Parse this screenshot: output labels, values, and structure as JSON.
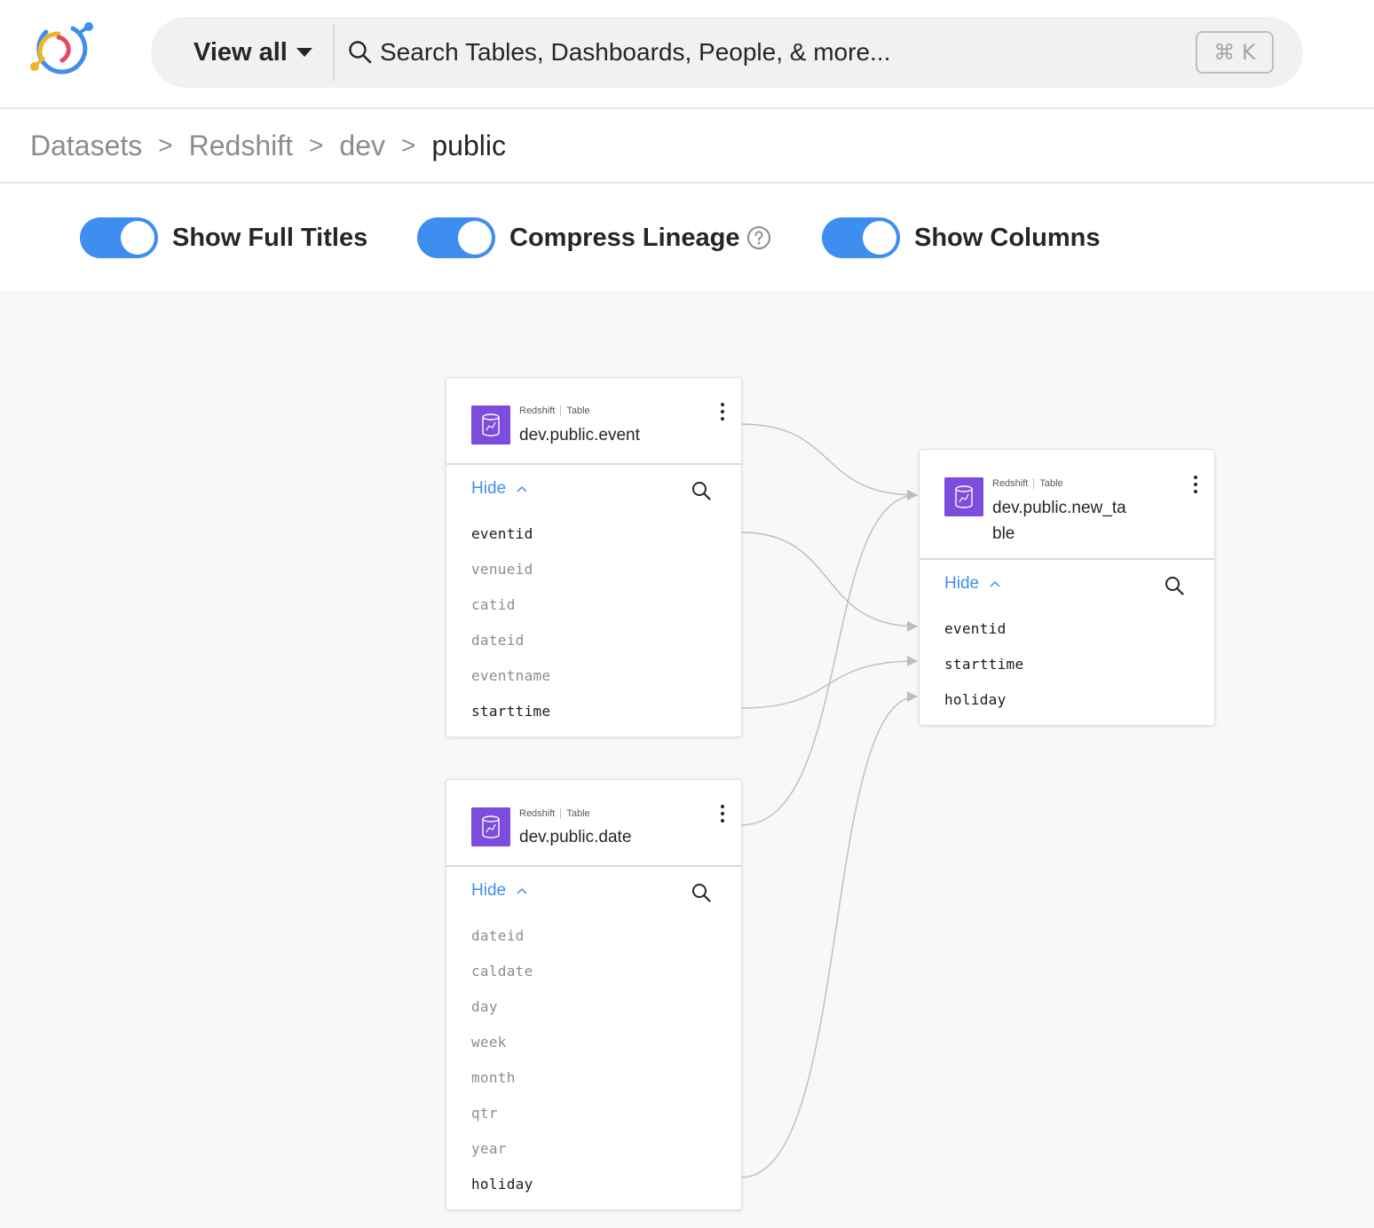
{
  "header": {
    "view_all_label": "View all",
    "search_placeholder": "Search Tables, Dashboards, People, & more...",
    "shortcut": "⌘ K"
  },
  "breadcrumb": [
    "Datasets",
    "Redshift",
    "dev",
    "public"
  ],
  "breadcrumb_sep": ">",
  "toggles": {
    "full_titles": {
      "label": "Show Full Titles",
      "on": true
    },
    "compress_lineage": {
      "label": "Compress Lineage",
      "on": true
    },
    "show_columns": {
      "label": "Show Columns",
      "on": true
    }
  },
  "colors": {
    "accent": "#3e8ef0",
    "node_icon": "#7c4ddc",
    "edge": "#bdbdbd"
  },
  "nodes": {
    "event": {
      "platform": "Redshift",
      "type": "Table",
      "title": "dev.public.event",
      "hide_label": "Hide",
      "columns": [
        "eventid",
        "venueid",
        "catid",
        "dateid",
        "eventname",
        "starttime"
      ],
      "active_columns": [
        "eventid",
        "starttime"
      ]
    },
    "date": {
      "platform": "Redshift",
      "type": "Table",
      "title": "dev.public.date",
      "hide_label": "Hide",
      "columns": [
        "dateid",
        "caldate",
        "day",
        "week",
        "month",
        "qtr",
        "year",
        "holiday"
      ],
      "active_columns": [
        "holiday"
      ]
    },
    "new_table": {
      "platform": "Redshift",
      "type": "Table",
      "title_line1": "dev.public.new_ta",
      "title_line2": "ble",
      "hide_label": "Hide",
      "columns": [
        "eventid",
        "starttime",
        "holiday"
      ],
      "active_columns": [
        "eventid",
        "starttime",
        "holiday"
      ]
    }
  },
  "lineage": [
    {
      "from": "dev.public.event",
      "to": "dev.public.new_table"
    },
    {
      "from": "dev.public.date",
      "to": "dev.public.new_table"
    },
    {
      "from": "dev.public.event.eventid",
      "to": "dev.public.new_table.eventid"
    },
    {
      "from": "dev.public.event.starttime",
      "to": "dev.public.new_table.starttime"
    },
    {
      "from": "dev.public.date.holiday",
      "to": "dev.public.new_table.holiday"
    }
  ]
}
